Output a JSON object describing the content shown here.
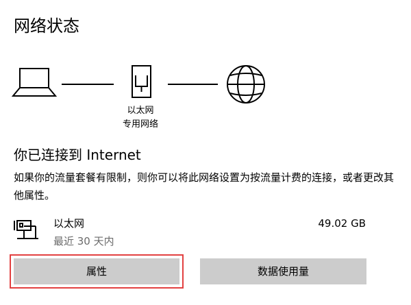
{
  "page": {
    "title": "网络状态"
  },
  "diagram": {
    "adapter_name": "以太网",
    "adapter_network": "专用网络",
    "icons": [
      "laptop-icon",
      "network-adapter-icon",
      "globe-icon"
    ]
  },
  "status": {
    "heading": "你已连接到 Internet",
    "description": "如果你的流量套餐有限制，则你可以将此网络设置为按流量计费的连接，或者更改其他属性。"
  },
  "connection": {
    "icon": "ethernet-icon",
    "name": "以太网",
    "period": "最近 30 天内",
    "usage": "49.02 GB"
  },
  "buttons": {
    "properties_label": "属性",
    "data_usage_label": "数据使用量"
  },
  "colors": {
    "button_bg": "#cccccc",
    "focus_ring": "#e24040",
    "secondary_text": "#6b6b6b"
  }
}
